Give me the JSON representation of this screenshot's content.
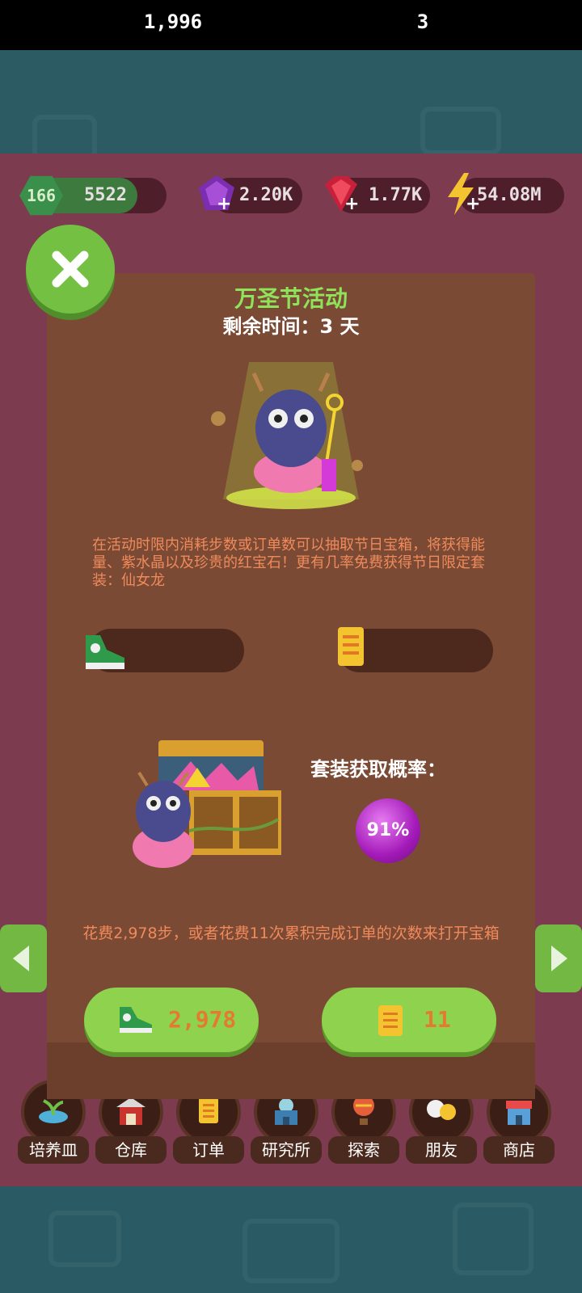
{
  "resources": {
    "level": "166",
    "steps_stat": "5522",
    "amethyst": "2.20K",
    "ruby": "1.77K",
    "energy": "54.08M"
  },
  "event": {
    "title": "万圣节活动",
    "remaining": "剩余时间：3 天",
    "description": "在活动时限内消耗步数或订单数可以抽取节日宝箱，将获得能量、紫水晶以及珍贵的红宝石！更有几率免费获得节日限定套装：仙女龙",
    "steps_owned": "1,996",
    "orders_owned": "3",
    "probability_label": "套装获取概率：",
    "probability": "91%",
    "cost_text": "花费2,978步，或者花费11次累积完成订单的次数来打开宝箱",
    "steps_cost": "2,978",
    "orders_cost": "11"
  },
  "nav": {
    "items": [
      {
        "label": "培养皿",
        "icon": "petri-dish-icon"
      },
      {
        "label": "仓库",
        "icon": "warehouse-icon"
      },
      {
        "label": "订单",
        "icon": "order-scroll-icon"
      },
      {
        "label": "研究所",
        "icon": "lab-icon"
      },
      {
        "label": "探索",
        "icon": "balloon-icon"
      },
      {
        "label": "朋友",
        "icon": "friends-icon"
      },
      {
        "label": "商店",
        "icon": "shop-icon"
      }
    ]
  },
  "colors": {
    "accent_green": "#8ed24e",
    "panel_brown": "#7a4a35",
    "title_green": "#8fe35b",
    "desc_orange": "#f08a5a"
  }
}
